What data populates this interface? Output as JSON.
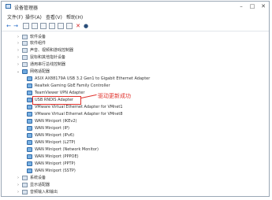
{
  "window": {
    "title": "设备管理器",
    "controls": {
      "minimize": "–",
      "maximize": "□",
      "close": "✕"
    }
  },
  "menu": [
    "文件(F)",
    "操作(A)",
    "查看(V)",
    "帮助(H)"
  ],
  "toolbar": {
    "back": "←",
    "forward": "→",
    "delete": "✕",
    "add": "●"
  },
  "tree": {
    "categories_top": [
      {
        "label": "软件设备"
      },
      {
        "label": "软件组件"
      },
      {
        "label": "声音、视频和游戏控制器"
      },
      {
        "label": "鼠标和其他指针设备"
      },
      {
        "label": "通用串行总线控制器"
      }
    ],
    "network_category": {
      "label": "网络适配器"
    },
    "network_adapters": [
      "ASIX AX88179A USB 3.2 Gen1 to Gigabit Ethernet Adapter",
      "Realtek Gaming GbE Family Controller",
      "TeamViewer VPN Adapter",
      "USB RNDIS Adapter",
      "VMware Virtual Ethernet Adapter for VMnet1",
      "VMware Virtual Ethernet Adapter for VMnet8",
      "WAN Miniport (IKEv2)",
      "WAN Miniport (IP)",
      "WAN Miniport (IPv6)",
      "WAN Miniport (L2TP)",
      "WAN Miniport (Network Monitor)",
      "WAN Miniport (PPPOE)",
      "WAN Miniport (PPTP)",
      "WAN Miniport (SSTP)"
    ],
    "categories_bottom": [
      {
        "label": "系统设备"
      },
      {
        "label": "显示适配器"
      },
      {
        "label": "音频输入和输出"
      }
    ]
  },
  "annotation": {
    "text": "驱动更新成功"
  },
  "colors": {
    "annotation": "#e0322c",
    "adapter_icon": "#6fa9de"
  }
}
